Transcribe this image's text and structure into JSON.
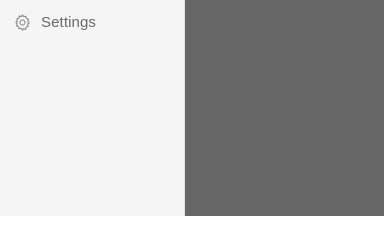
{
  "drawer": {
    "items": [
      {
        "label": "Settings",
        "icon": "gear-icon"
      }
    ]
  },
  "colors": {
    "drawer_background": "#f5f5f5",
    "scrim": "#666666",
    "text": "#6a6a6a"
  }
}
